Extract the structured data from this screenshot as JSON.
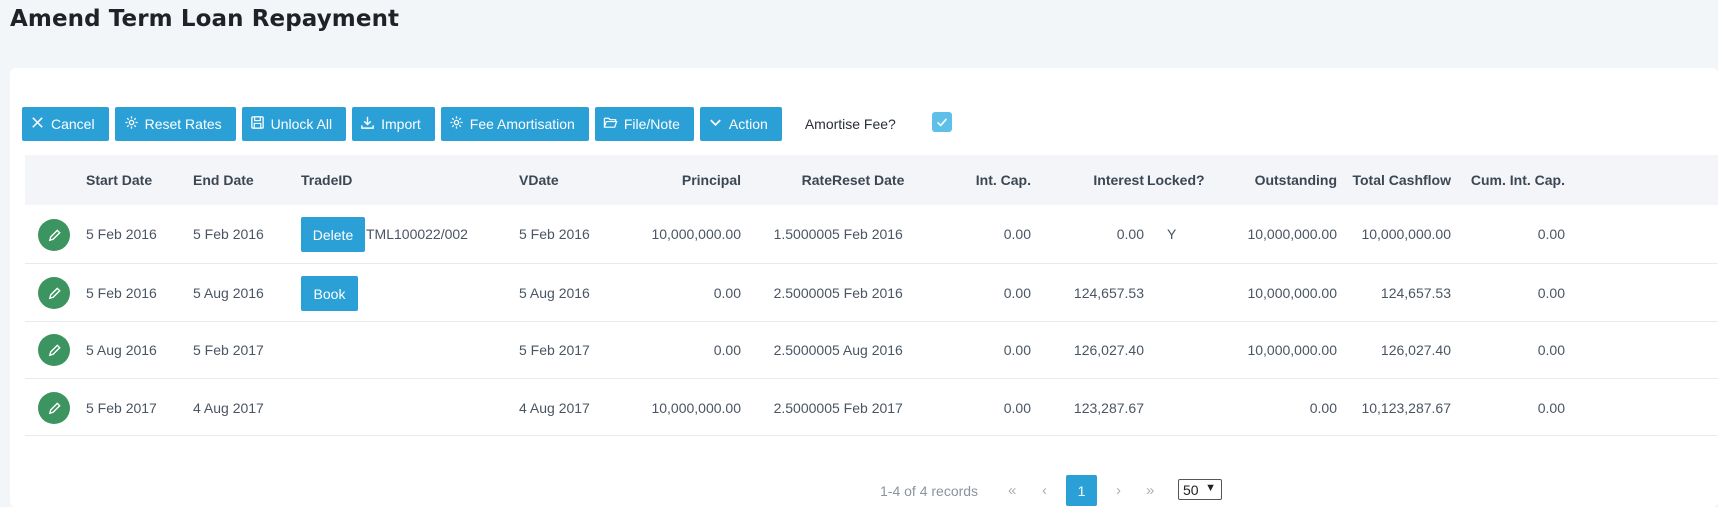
{
  "page": {
    "title": "Amend Term Loan Repayment"
  },
  "toolbar": {
    "buttons": [
      {
        "label": "Cancel",
        "icon": "close-icon"
      },
      {
        "label": "Reset Rates",
        "icon": "gear-icon"
      },
      {
        "label": "Unlock All",
        "icon": "save-icon"
      },
      {
        "label": "Import",
        "icon": "download-icon"
      },
      {
        "label": "Fee Amortisation",
        "icon": "gear-icon"
      },
      {
        "label": "File/Note",
        "icon": "folder-open-icon"
      },
      {
        "label": "Action",
        "icon": "chevron-down-icon"
      }
    ],
    "amortise_label": "Amortise Fee?",
    "amortise_checked": true
  },
  "grid": {
    "headers": {
      "start_date": "Start Date",
      "end_date": "End Date",
      "trade_id": "TradeID",
      "vdate": "VDate",
      "principal": "Principal",
      "rate": "Rate",
      "reset_date": "Reset Date",
      "int_cap": "Int. Cap.",
      "interest": "Interest",
      "locked": "Locked?",
      "outstanding": "Outstanding",
      "total_cashflow": "Total Cashflow",
      "cum_int_cap": "Cum. Int. Cap."
    },
    "rows": [
      {
        "start_date": "5 Feb 2016",
        "end_date": "5 Feb 2016",
        "action_label": "Delete",
        "trade_id": "TML100022/002",
        "vdate": "5 Feb 2016",
        "principal": "10,000,000.00",
        "rate": "1.500000",
        "reset_date": "5 Feb 2016",
        "int_cap": "0.00",
        "interest": "0.00",
        "locked": "Y",
        "outstanding": "10,000,000.00",
        "total_cashflow": "10,000,000.00",
        "cum_int_cap": "0.00"
      },
      {
        "start_date": "5 Feb 2016",
        "end_date": "5 Aug 2016",
        "action_label": "Book",
        "trade_id": "",
        "vdate": "5 Aug 2016",
        "principal": "0.00",
        "rate": "2.500000",
        "reset_date": "5 Feb 2016",
        "int_cap": "0.00",
        "interest": "124,657.53",
        "locked": "",
        "outstanding": "10,000,000.00",
        "total_cashflow": "124,657.53",
        "cum_int_cap": "0.00"
      },
      {
        "start_date": "5 Aug 2016",
        "end_date": "5 Feb 2017",
        "action_label": "",
        "trade_id": "",
        "vdate": "5 Feb 2017",
        "principal": "0.00",
        "rate": "2.500000",
        "reset_date": "5 Aug 2016",
        "int_cap": "0.00",
        "interest": "126,027.40",
        "locked": "",
        "outstanding": "10,000,000.00",
        "total_cashflow": "126,027.40",
        "cum_int_cap": "0.00"
      },
      {
        "start_date": "5 Feb 2017",
        "end_date": "4 Aug 2017",
        "action_label": "",
        "trade_id": "",
        "vdate": "4 Aug 2017",
        "principal": "10,000,000.00",
        "rate": "2.500000",
        "reset_date": "5 Feb 2017",
        "int_cap": "0.00",
        "interest": "123,287.67",
        "locked": "",
        "outstanding": "0.00",
        "total_cashflow": "10,123,287.67",
        "cum_int_cap": "0.00"
      }
    ]
  },
  "pager": {
    "info": "1-4 of 4 records",
    "current_page": "1",
    "page_size": "50"
  },
  "colors": {
    "accent": "#2aa0d6",
    "edit": "#3c9460",
    "checkbox": "#5ec0e8"
  }
}
